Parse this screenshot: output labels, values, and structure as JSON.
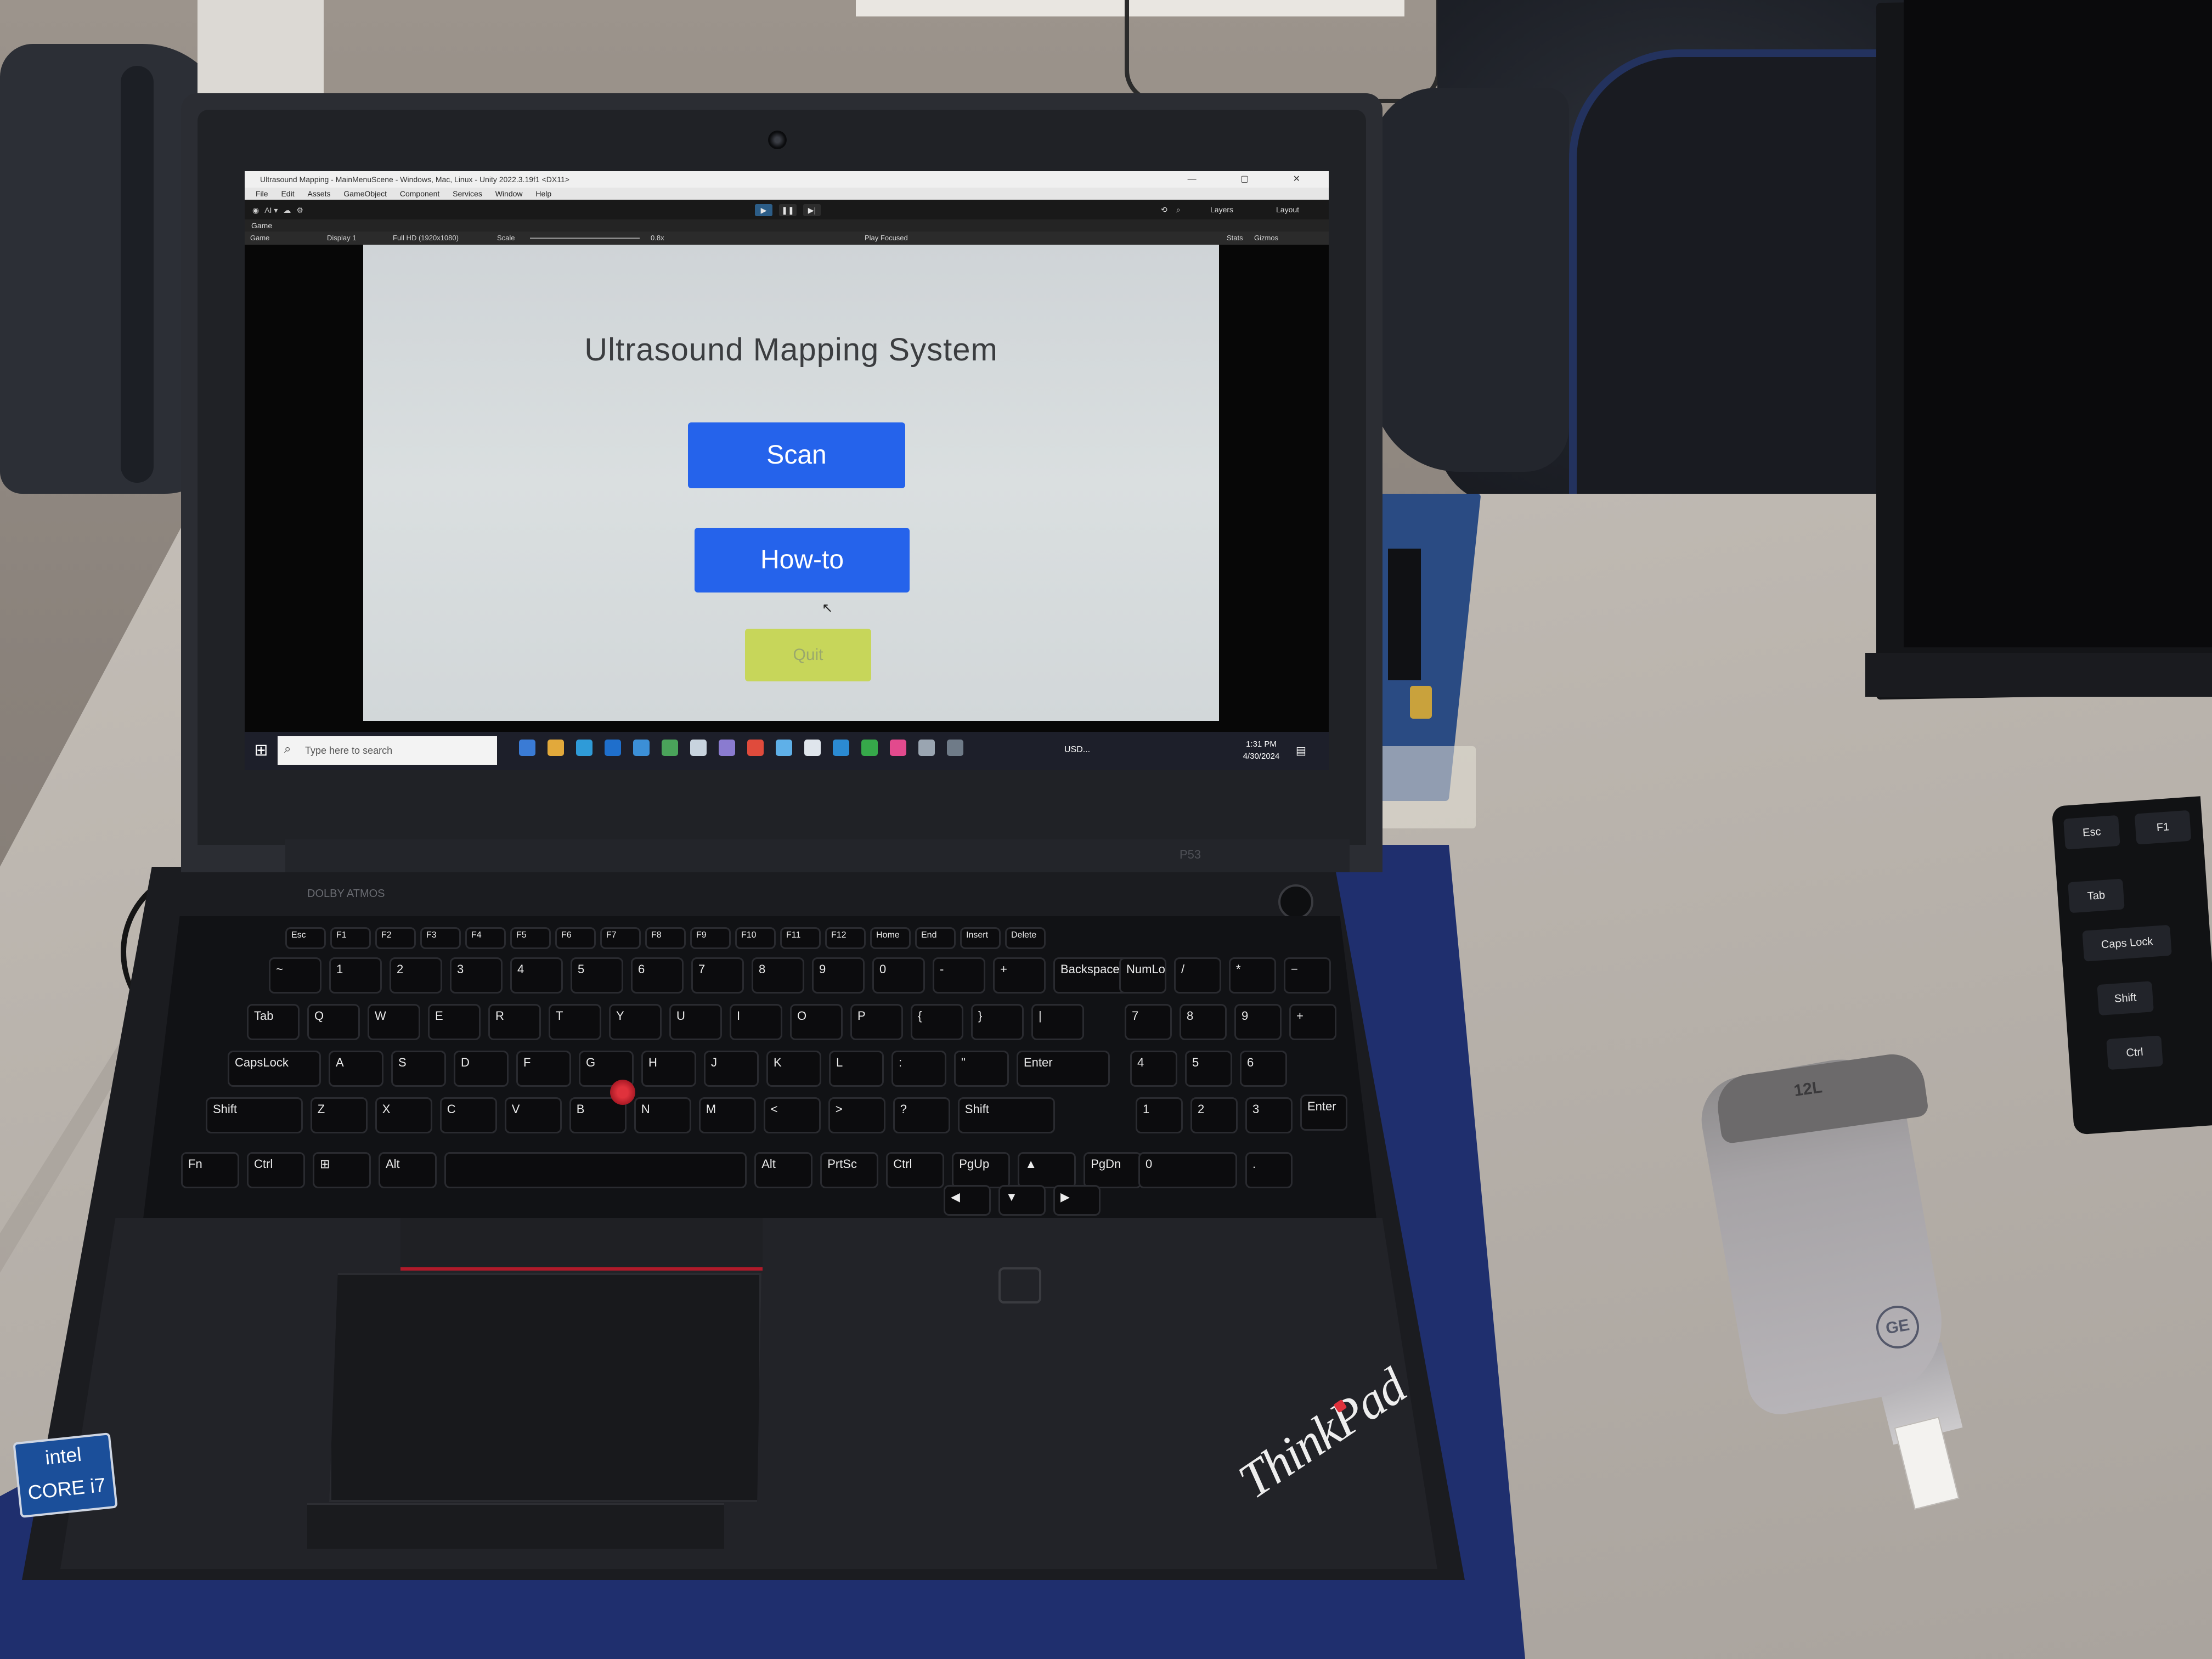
{
  "unity": {
    "window_title": "Ultrasound Mapping - MainMenuScene - Windows, Mac, Linux - Unity 2022.3.19f1 <DX11>",
    "window_controls": "— ▢ ✕",
    "menu": [
      "File",
      "Edit",
      "Assets",
      "GameObject",
      "Component",
      "Services",
      "Window",
      "Help"
    ],
    "account_label": "AI ▾",
    "layers_label": "Layers",
    "layout_label": "Layout",
    "game_tab": "Game",
    "game_controls": {
      "mode": "Game",
      "display": "Display 1",
      "resolution": "Full HD (1920x1080)",
      "scale_label": "Scale",
      "scale_value": "0.8x",
      "play_mode": "Play Focused",
      "stats": "Stats",
      "gizmos": "Gizmos"
    }
  },
  "app": {
    "title": "Ultrasound Mapping System",
    "scan_label": "Scan",
    "howto_label": "How-to",
    "quit_label": "Quit",
    "colors": {
      "primary_button": "#2563eb",
      "quit_button": "#c7d65a",
      "background": "#d5dadc",
      "title_text": "#3b3d40"
    }
  },
  "taskbar": {
    "search_placeholder": "Type here to search",
    "ticker": "USD...",
    "time": "1:31 PM",
    "date": "4/30/2024"
  },
  "laptop": {
    "brand_logo": "ThinkPad",
    "model": "P53",
    "sticker": "intel CORE i7",
    "audio_badge": "DOLBY ATMOS",
    "keys": {
      "fn_row": [
        "Esc",
        "F1",
        "F2",
        "F3",
        "F4",
        "F5",
        "F6",
        "F7",
        "F8",
        "F9",
        "F10",
        "F11",
        "F12",
        "Home",
        "End",
        "Insert",
        "Delete"
      ],
      "row1": [
        "~",
        "1",
        "2",
        "3",
        "4",
        "5",
        "6",
        "7",
        "8",
        "9",
        "0",
        "-",
        "+",
        "Backspace"
      ],
      "row2": [
        "Tab",
        "Q",
        "W",
        "E",
        "R",
        "T",
        "Y",
        "U",
        "I",
        "O",
        "P",
        "{",
        "}",
        "|"
      ],
      "row3": [
        "CapsLock",
        "A",
        "S",
        "D",
        "F",
        "G",
        "H",
        "J",
        "K",
        "L",
        ":",
        "\"",
        "Enter"
      ],
      "row4": [
        "Shift",
        "Z",
        "X",
        "C",
        "V",
        "B",
        "N",
        "M",
        "<",
        ">",
        "?",
        "Shift"
      ],
      "row5": [
        "Fn",
        "Ctrl",
        "⊞",
        "Alt",
        "",
        "Alt",
        "PrtSc",
        "Ctrl",
        "PgUp",
        "▲",
        "PgDn"
      ],
      "nav": [
        "◀",
        "▼",
        "▶"
      ],
      "numpad": [
        "NumLock",
        "/",
        "*",
        "−",
        "7",
        "8",
        "9",
        "+",
        "4",
        "5",
        "6",
        "1",
        "2",
        "3",
        "Enter",
        "0",
        "."
      ]
    }
  },
  "probe": {
    "label": "12L",
    "logo": "GE"
  },
  "external_keyboard": {
    "keys": [
      "Esc",
      "F1",
      "Tab",
      "Caps Lock",
      "Shift",
      "Ctrl"
    ]
  }
}
